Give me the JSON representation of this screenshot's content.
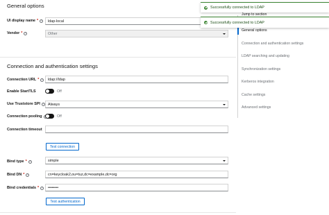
{
  "sections": {
    "general": "General options",
    "connection": "Connection and authentication settings"
  },
  "fields": {
    "ui_display_name": {
      "label": "UI display name",
      "value": "ldap-local"
    },
    "vendor": {
      "label": "Vendor",
      "value": "Other"
    },
    "connection_url": {
      "label": "Connection URL",
      "value": "ldap://ldap"
    },
    "enable_starttls": {
      "label": "Enable StartTLS",
      "state": "Off"
    },
    "use_truststore_spi": {
      "label": "Use Truststore SPI",
      "value": "Always"
    },
    "connection_pooling": {
      "label": "Connection pooling",
      "state": "Off"
    },
    "connection_timeout": {
      "label": "Connection timeout",
      "value": ""
    },
    "bind_type": {
      "label": "Bind type",
      "value": "simple"
    },
    "bind_dn": {
      "label": "Bind DN",
      "value": "cn=keycloak2,ou=tuz,dc=example,dc=org"
    },
    "bind_credentials": {
      "label": "Bind credentials",
      "value": "••••••••"
    }
  },
  "buttons": {
    "test_connection": "Test connection",
    "test_authentication": "Test authentication"
  },
  "jump": {
    "title": "Jump to section",
    "items": [
      "General options",
      "Connection and authentication settings",
      "LDAP searching and updating",
      "Synchronization settings",
      "Kerberos integration",
      "Cache settings",
      "Advanced settings"
    ]
  },
  "toasts": [
    "Successfully connected to LDAP",
    "Successfully connected to LDAP"
  ],
  "symbols": {
    "required": "*",
    "help": "?"
  },
  "colors": {
    "primary": "#0066cc",
    "success": "#3e8635",
    "required": "#c9190b"
  }
}
